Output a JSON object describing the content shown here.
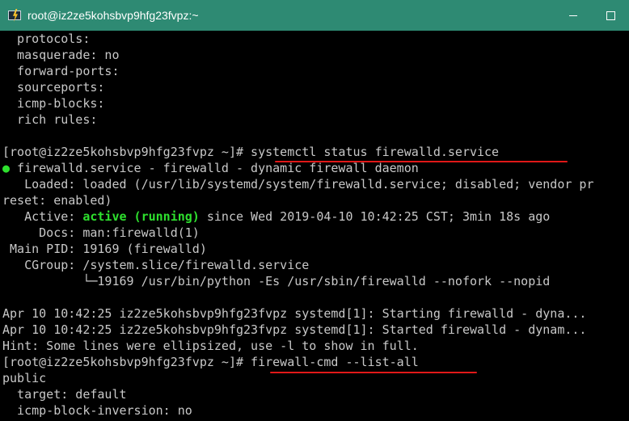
{
  "window": {
    "title": "root@iz2ze5kohsbvp9hfg23fvpz:~",
    "icon": "putty-icon"
  },
  "terminal": {
    "lines": [
      {
        "text": "  protocols:"
      },
      {
        "text": "  masquerade: no"
      },
      {
        "text": "  forward-ports:"
      },
      {
        "text": "  sourceports:"
      },
      {
        "text": "  icmp-blocks:"
      },
      {
        "text": "  rich rules:"
      },
      {
        "text": ""
      },
      {
        "prompt": "[root@iz2ze5kohsbvp9hfg23fvpz ~]# ",
        "command": "systemctl status firewalld.service"
      },
      {
        "bullet": "●",
        "text": " firewalld.service - firewalld - dynamic firewall daemon"
      },
      {
        "text": "   Loaded: loaded (/usr/lib/systemd/system/firewalld.service; disabled; vendor pr"
      },
      {
        "text": "reset: enabled)"
      },
      {
        "pre": "   Active: ",
        "highlight": "active (running)",
        "post": " since Wed 2019-04-10 10:42:25 CST; 3min 18s ago"
      },
      {
        "text": "     Docs: man:firewalld(1)"
      },
      {
        "text": " Main PID: 19169 (firewalld)"
      },
      {
        "text": "   CGroup: /system.slice/firewalld.service"
      },
      {
        "text": "           └─19169 /usr/bin/python -Es /usr/sbin/firewalld --nofork --nopid"
      },
      {
        "text": ""
      },
      {
        "text": "Apr 10 10:42:25 iz2ze5kohsbvp9hfg23fvpz systemd[1]: Starting firewalld - dyna..."
      },
      {
        "text": "Apr 10 10:42:25 iz2ze5kohsbvp9hfg23fvpz systemd[1]: Started firewalld - dynam..."
      },
      {
        "text": "Hint: Some lines were ellipsized, use -l to show in full."
      },
      {
        "prompt": "[root@iz2ze5kohsbvp9hfg23fvpz ~]# ",
        "command": "firewall-cmd --list-all"
      },
      {
        "text": "public"
      },
      {
        "text": "  target: default"
      },
      {
        "text": "  icmp-block-inversion: no"
      }
    ]
  },
  "colors": {
    "titlebar": "#2e8a73",
    "text": "#c8c8c8",
    "active_green": "#2ee02e",
    "annotation_red": "#e01818"
  }
}
